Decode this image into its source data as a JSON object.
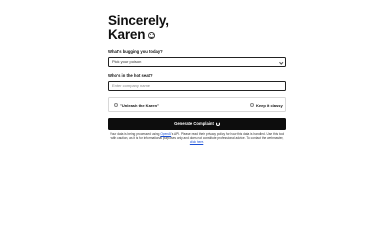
{
  "title": {
    "line1": "Sincerely,",
    "line2": "Karen",
    "emoji_icon": "smile-face-icon"
  },
  "topic": {
    "label": "What's bugging you today?",
    "selected": "Pick your poison"
  },
  "target": {
    "label": "Who's in the hot seat?",
    "placeholder": "Enter company name"
  },
  "mode": {
    "option_left": "\"Unleash the Karen\"",
    "option_right": "Keep it classy",
    "left_selected": false,
    "right_selected": false
  },
  "generate": {
    "label": "Generate Complaint",
    "icon": "spinner-icon"
  },
  "disclaimer": {
    "prefix": "Your data is being processed using ",
    "openai_link": "OpenAI",
    "middle": "'s API. Please read their privacy policy for how this data is handled. Use this tool with caution, as it is for informational purposes only and does not constitute professional advice. To contact the webmaster, ",
    "contact_link": "click here",
    "suffix": "."
  }
}
